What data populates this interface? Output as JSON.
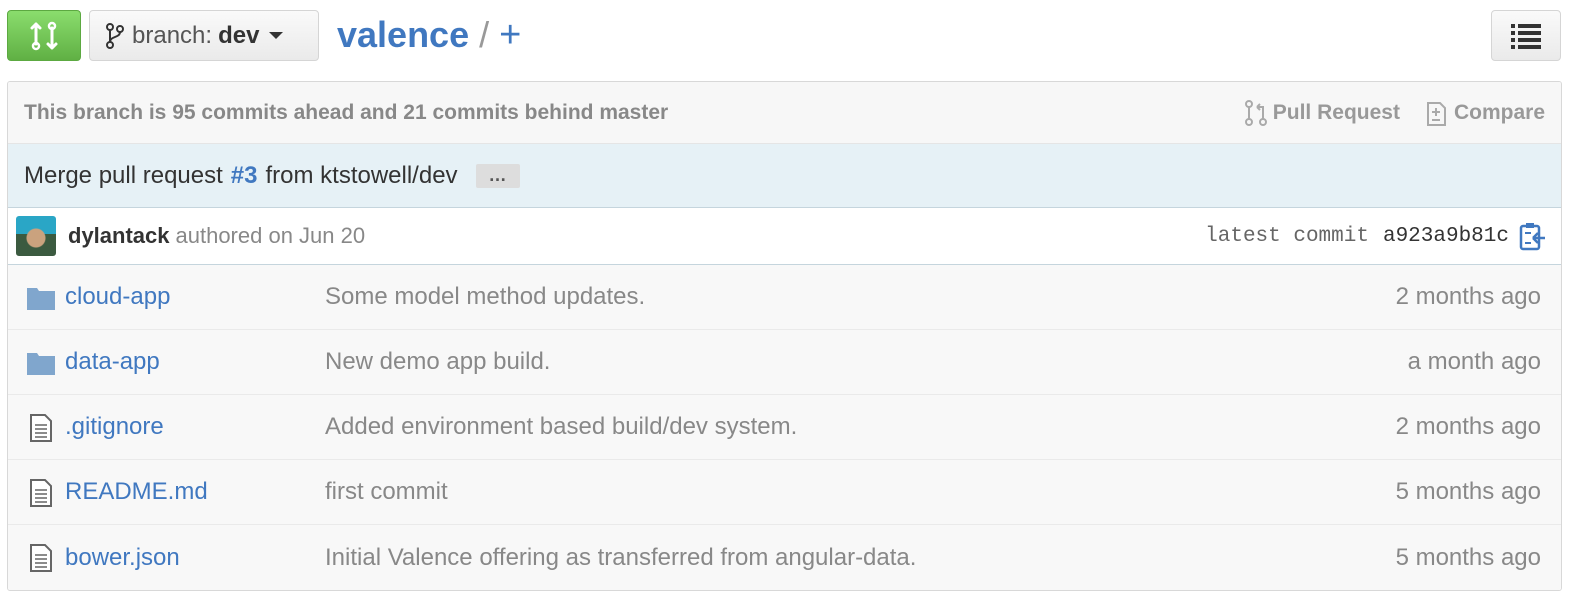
{
  "header": {
    "branch_label": "branch:",
    "branch_value": "dev",
    "repo": "valence",
    "separator": "/",
    "new_file": "+"
  },
  "tease": {
    "message": "This branch is 95 commits ahead and 21 commits behind master",
    "pull_request": "Pull Request",
    "compare": "Compare"
  },
  "commit": {
    "title_prefix": "Merge pull request",
    "pr_number": "#3",
    "title_suffix": "from ktstowell/dev",
    "expand": "…",
    "author": "dylantack",
    "authored": "authored on Jun 20",
    "latest_label": "latest commit",
    "sha": "a923a9b81c"
  },
  "files": [
    {
      "type": "folder",
      "name": "cloud-app",
      "message": "Some model method updates.",
      "age": "2 months ago"
    },
    {
      "type": "folder",
      "name": "data-app",
      "message": "New demo app build.",
      "age": "a month ago"
    },
    {
      "type": "file",
      "name": ".gitignore",
      "message": "Added environment based build/dev system.",
      "age": "2 months ago"
    },
    {
      "type": "file",
      "name": "README.md",
      "message": "first commit",
      "age": "5 months ago"
    },
    {
      "type": "file",
      "name": "bower.json",
      "message": "Initial Valence offering as transferred from angular-data.",
      "age": "5 months ago"
    }
  ],
  "colors": {
    "link": "#4078c0",
    "compare_green": "#60b044",
    "commit_bg": "#e6f1f6",
    "folder": "#80a6cd"
  },
  "icons": {
    "compare_button": "compare-arrows-icon",
    "branch": "git-branch-icon",
    "list": "list-icon",
    "pull_request": "pull-request-icon",
    "compare": "diff-icon",
    "clipboard": "clipboard-icon",
    "folder": "folder-icon",
    "file": "file-text-icon"
  }
}
